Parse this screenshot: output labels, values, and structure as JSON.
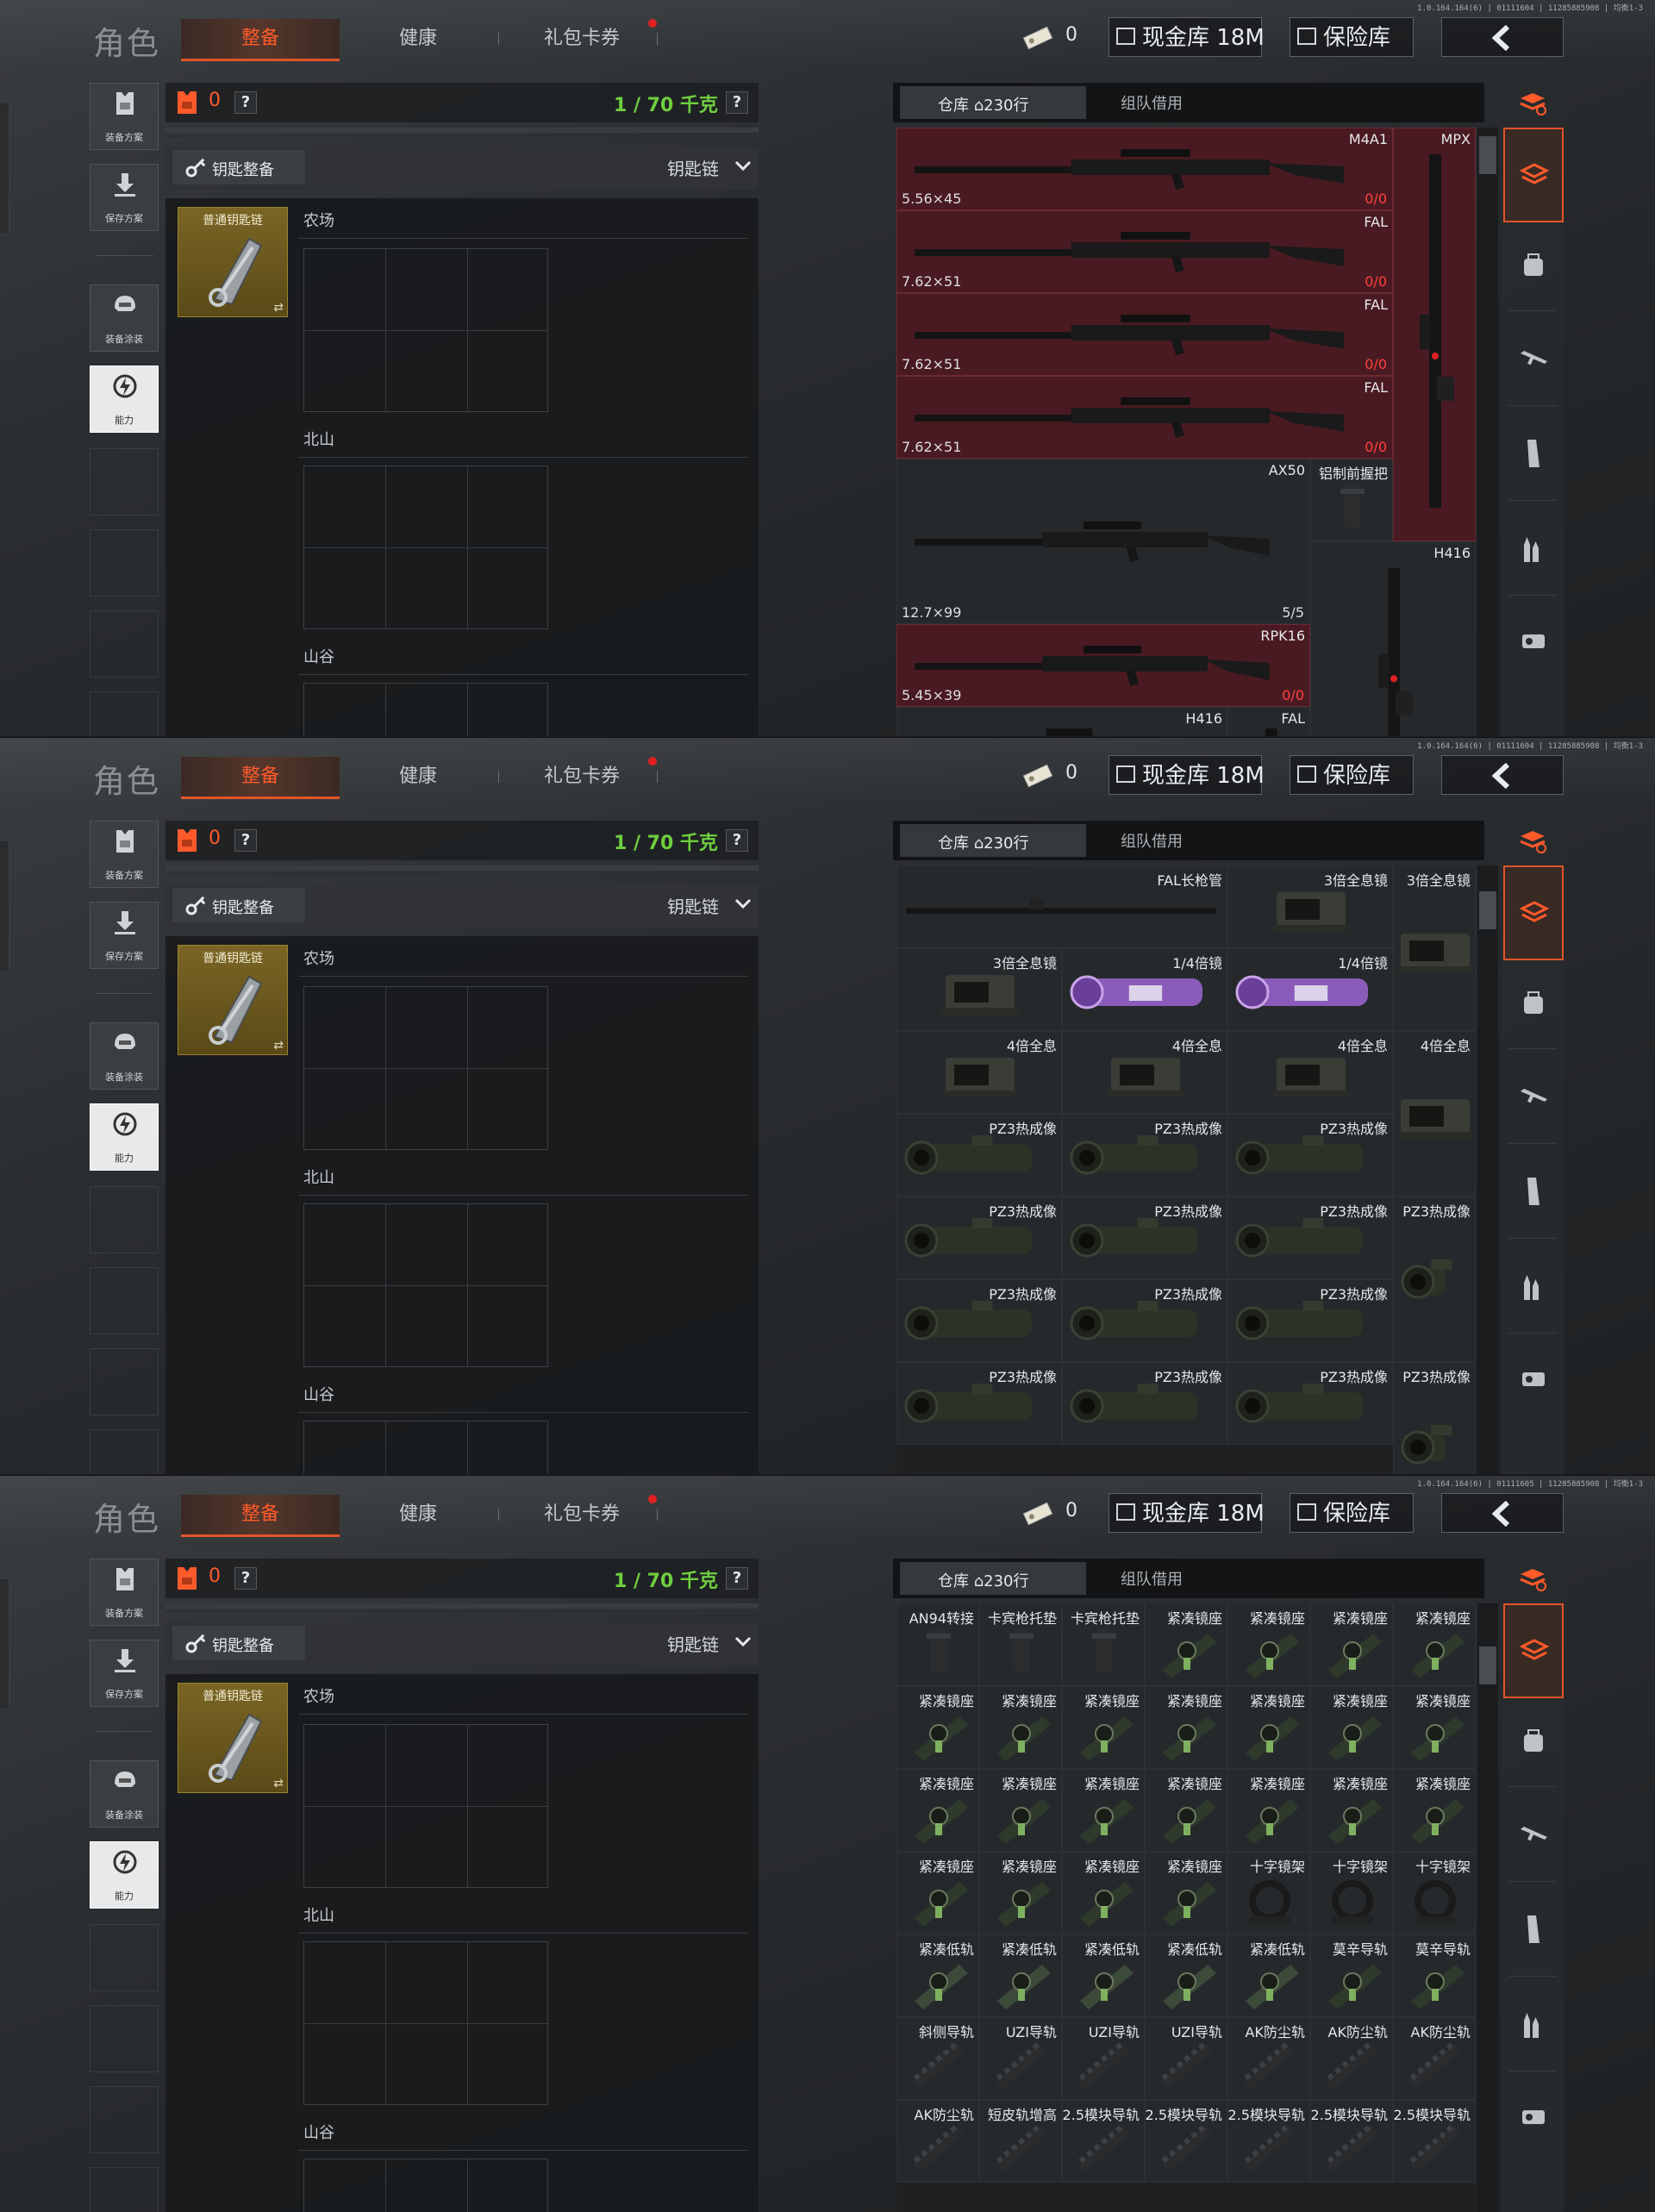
{
  "panels": [
    {
      "build": "1.0.164.164(6) | 01111604 | 11285885908 | 均衡1-3",
      "grid": [
        {
          "type": "gun",
          "red": true,
          "name": "M4A1",
          "caliber": "5.56×45",
          "ammo": "0/0",
          "c": 0,
          "r": 0,
          "w": 6,
          "h": 1
        },
        {
          "type": "gun",
          "red": true,
          "name": "MPX",
          "caliber": "",
          "ammo": "",
          "c": 6,
          "r": 0,
          "w": 1,
          "h": 5,
          "vertical": true
        },
        {
          "type": "gun",
          "red": true,
          "name": "FAL",
          "caliber": "7.62×51",
          "ammo": "0/0",
          "c": 0,
          "r": 1,
          "w": 6,
          "h": 1
        },
        {
          "type": "gun",
          "red": true,
          "name": "FAL",
          "caliber": "7.62×51",
          "ammo": "0/0",
          "c": 0,
          "r": 2,
          "w": 6,
          "h": 1
        },
        {
          "type": "gun",
          "red": true,
          "name": "FAL",
          "caliber": "7.62×51",
          "ammo": "0/0",
          "c": 0,
          "r": 3,
          "w": 6,
          "h": 1
        },
        {
          "type": "gun",
          "red": false,
          "name": "AX50",
          "caliber": "12.7×99",
          "ammo": "5/5",
          "c": 0,
          "r": 4,
          "w": 5,
          "h": 2
        },
        {
          "type": "part",
          "red": false,
          "name": "铝制前握把",
          "caliber": "",
          "ammo": "",
          "c": 5,
          "r": 4,
          "w": 1,
          "h": 1
        },
        {
          "type": "gun",
          "red": false,
          "name": "H416",
          "caliber": "",
          "ammo": "",
          "c": 5,
          "r": 5,
          "w": 2,
          "h": 3,
          "vertical": true
        },
        {
          "type": "gun",
          "red": true,
          "name": "RPK16",
          "caliber": "5.45×39",
          "ammo": "0/0",
          "c": 0,
          "r": 6,
          "w": 5,
          "h": 1
        },
        {
          "type": "gun",
          "red": false,
          "name": "H416",
          "caliber": "",
          "ammo": "",
          "c": 0,
          "r": 7,
          "w": 4,
          "h": 1
        },
        {
          "type": "gun",
          "red": false,
          "name": "FAL",
          "caliber": "",
          "ammo": "",
          "c": 4,
          "r": 7,
          "w": 1,
          "h": 1
        }
      ]
    },
    {
      "build": "1.0.164.164(6) | 01111604 | 11285885908 | 均衡1-3",
      "grid": [
        {
          "type": "barrel",
          "name": "FAL长枪管",
          "c": 0,
          "r": 0,
          "w": 4,
          "h": 1
        },
        {
          "type": "scope",
          "name": "3倍全息镜",
          "c": 4,
          "r": 0,
          "w": 2,
          "h": 1
        },
        {
          "type": "scope",
          "name": "3倍全息镜",
          "c": 6,
          "r": 0,
          "w": 1,
          "h": 2
        },
        {
          "type": "scope",
          "name": "3倍全息镜",
          "c": 0,
          "r": 1,
          "w": 2,
          "h": 1
        },
        {
          "type": "purple",
          "name": "1/4倍镜",
          "c": 2,
          "r": 1,
          "w": 2,
          "h": 1
        },
        {
          "type": "purple",
          "name": "1/4倍镜",
          "c": 4,
          "r": 1,
          "w": 2,
          "h": 1
        },
        {
          "type": "scope",
          "name": "4倍全息",
          "c": 0,
          "r": 2,
          "w": 2,
          "h": 1
        },
        {
          "type": "scope",
          "name": "4倍全息",
          "c": 2,
          "r": 2,
          "w": 2,
          "h": 1
        },
        {
          "type": "scope",
          "name": "4倍全息",
          "c": 4,
          "r": 2,
          "w": 2,
          "h": 1
        },
        {
          "type": "scope",
          "name": "4倍全息",
          "c": 6,
          "r": 2,
          "w": 1,
          "h": 2
        },
        {
          "type": "thermal",
          "name": "PZ3热成像",
          "c": 0,
          "r": 3,
          "w": 2,
          "h": 1
        },
        {
          "type": "thermal",
          "name": "PZ3热成像",
          "c": 2,
          "r": 3,
          "w": 2,
          "h": 1
        },
        {
          "type": "thermal",
          "name": "PZ3热成像",
          "c": 4,
          "r": 3,
          "w": 2,
          "h": 1
        },
        {
          "type": "thermal",
          "name": "PZ3热成像",
          "c": 0,
          "r": 4,
          "w": 2,
          "h": 1
        },
        {
          "type": "thermal",
          "name": "PZ3热成像",
          "c": 2,
          "r": 4,
          "w": 2,
          "h": 1
        },
        {
          "type": "thermal",
          "name": "PZ3热成像",
          "c": 4,
          "r": 4,
          "w": 2,
          "h": 1
        },
        {
          "type": "thermal",
          "name": "PZ3热成像",
          "c": 6,
          "r": 4,
          "w": 1,
          "h": 2
        },
        {
          "type": "thermal",
          "name": "PZ3热成像",
          "c": 0,
          "r": 5,
          "w": 2,
          "h": 1
        },
        {
          "type": "thermal",
          "name": "PZ3热成像",
          "c": 2,
          "r": 5,
          "w": 2,
          "h": 1
        },
        {
          "type": "thermal",
          "name": "PZ3热成像",
          "c": 4,
          "r": 5,
          "w": 2,
          "h": 1
        },
        {
          "type": "thermal",
          "name": "PZ3热成像",
          "c": 0,
          "r": 6,
          "w": 2,
          "h": 1
        },
        {
          "type": "thermal",
          "name": "PZ3热成像",
          "c": 2,
          "r": 6,
          "w": 2,
          "h": 1
        },
        {
          "type": "thermal",
          "name": "PZ3热成像",
          "c": 4,
          "r": 6,
          "w": 2,
          "h": 1
        },
        {
          "type": "thermal",
          "name": "PZ3热成像",
          "c": 6,
          "r": 6,
          "w": 1,
          "h": 2
        }
      ]
    },
    {
      "build": "1.0.164.164(6) | 01111605 | 11285885908 | 均衡1-3",
      "grid": [
        {
          "type": "part",
          "name": "AN94转接",
          "c": 0,
          "r": 0,
          "w": 1,
          "h": 1
        },
        {
          "type": "part",
          "name": "卡宾枪托垫",
          "c": 1,
          "r": 0,
          "w": 1,
          "h": 1
        },
        {
          "type": "part",
          "name": "卡宾枪托垫",
          "c": 2,
          "r": 0,
          "w": 1,
          "h": 1
        },
        {
          "type": "mount",
          "name": "紧凑镜座",
          "c": 3,
          "r": 0,
          "w": 1,
          "h": 1
        },
        {
          "type": "mount",
          "name": "紧凑镜座",
          "c": 4,
          "r": 0,
          "w": 1,
          "h": 1
        },
        {
          "type": "mount",
          "name": "紧凑镜座",
          "c": 5,
          "r": 0,
          "w": 1,
          "h": 1
        },
        {
          "type": "mount",
          "name": "紧凑镜座",
          "c": 6,
          "r": 0,
          "w": 1,
          "h": 1
        },
        {
          "type": "mount",
          "name": "紧凑镜座",
          "c": 0,
          "r": 1,
          "w": 1,
          "h": 1
        },
        {
          "type": "mount",
          "name": "紧凑镜座",
          "c": 1,
          "r": 1,
          "w": 1,
          "h": 1
        },
        {
          "type": "mount",
          "name": "紧凑镜座",
          "c": 2,
          "r": 1,
          "w": 1,
          "h": 1
        },
        {
          "type": "mount",
          "name": "紧凑镜座",
          "c": 3,
          "r": 1,
          "w": 1,
          "h": 1
        },
        {
          "type": "mount",
          "name": "紧凑镜座",
          "c": 4,
          "r": 1,
          "w": 1,
          "h": 1
        },
        {
          "type": "mount",
          "name": "紧凑镜座",
          "c": 5,
          "r": 1,
          "w": 1,
          "h": 1
        },
        {
          "type": "mount",
          "name": "紧凑镜座",
          "c": 6,
          "r": 1,
          "w": 1,
          "h": 1
        },
        {
          "type": "mount",
          "name": "紧凑镜座",
          "c": 0,
          "r": 2,
          "w": 1,
          "h": 1
        },
        {
          "type": "mount",
          "name": "紧凑镜座",
          "c": 1,
          "r": 2,
          "w": 1,
          "h": 1
        },
        {
          "type": "mount",
          "name": "紧凑镜座",
          "c": 2,
          "r": 2,
          "w": 1,
          "h": 1
        },
        {
          "type": "mount",
          "name": "紧凑镜座",
          "c": 3,
          "r": 2,
          "w": 1,
          "h": 1
        },
        {
          "type": "mount",
          "name": "紧凑镜座",
          "c": 4,
          "r": 2,
          "w": 1,
          "h": 1
        },
        {
          "type": "mount",
          "name": "紧凑镜座",
          "c": 5,
          "r": 2,
          "w": 1,
          "h": 1
        },
        {
          "type": "mount",
          "name": "紧凑镜座",
          "c": 6,
          "r": 2,
          "w": 1,
          "h": 1
        },
        {
          "type": "mount",
          "name": "紧凑镜座",
          "c": 0,
          "r": 3,
          "w": 1,
          "h": 1
        },
        {
          "type": "mount",
          "name": "紧凑镜座",
          "c": 1,
          "r": 3,
          "w": 1,
          "h": 1
        },
        {
          "type": "mount",
          "name": "紧凑镜座",
          "c": 2,
          "r": 3,
          "w": 1,
          "h": 1
        },
        {
          "type": "mount",
          "name": "紧凑镜座",
          "c": 3,
          "r": 3,
          "w": 1,
          "h": 1
        },
        {
          "type": "ring",
          "name": "十字镜架",
          "c": 4,
          "r": 3,
          "w": 1,
          "h": 1
        },
        {
          "type": "ring",
          "name": "十字镜架",
          "c": 5,
          "r": 3,
          "w": 1,
          "h": 1
        },
        {
          "type": "ring",
          "name": "十字镜架",
          "c": 6,
          "r": 3,
          "w": 1,
          "h": 1
        },
        {
          "type": "lowrail",
          "name": "紧凑低轨",
          "c": 0,
          "r": 4,
          "w": 1,
          "h": 1
        },
        {
          "type": "lowrail",
          "name": "紧凑低轨",
          "c": 1,
          "r": 4,
          "w": 1,
          "h": 1
        },
        {
          "type": "lowrail",
          "name": "紧凑低轨",
          "c": 2,
          "r": 4,
          "w": 1,
          "h": 1
        },
        {
          "type": "lowrail",
          "name": "紧凑低轨",
          "c": 3,
          "r": 4,
          "w": 1,
          "h": 1
        },
        {
          "type": "lowrail",
          "name": "紧凑低轨",
          "c": 4,
          "r": 4,
          "w": 1,
          "h": 1
        },
        {
          "type": "mount",
          "name": "莫辛导轨",
          "c": 5,
          "r": 4,
          "w": 1,
          "h": 1
        },
        {
          "type": "mount",
          "name": "莫辛导轨",
          "c": 6,
          "r": 4,
          "w": 1,
          "h": 1
        },
        {
          "type": "rail",
          "name": "斜侧导轨",
          "c": 0,
          "r": 5,
          "w": 1,
          "h": 1
        },
        {
          "type": "rail",
          "name": "UZI导轨",
          "c": 1,
          "r": 5,
          "w": 1,
          "h": 1
        },
        {
          "type": "rail",
          "name": "UZI导轨",
          "c": 2,
          "r": 5,
          "w": 1,
          "h": 1
        },
        {
          "type": "rail",
          "name": "UZI导轨",
          "c": 3,
          "r": 5,
          "w": 1,
          "h": 1
        },
        {
          "type": "rail",
          "name": "AK防尘轨",
          "c": 4,
          "r": 5,
          "w": 1,
          "h": 1
        },
        {
          "type": "rail",
          "name": "AK防尘轨",
          "c": 5,
          "r": 5,
          "w": 1,
          "h": 1
        },
        {
          "type": "rail",
          "name": "AK防尘轨",
          "c": 6,
          "r": 5,
          "w": 1,
          "h": 1
        },
        {
          "type": "rail",
          "name": "AK防尘轨",
          "c": 0,
          "r": 6,
          "w": 1,
          "h": 1
        },
        {
          "type": "rail",
          "name": "短皮轨增高",
          "c": 1,
          "r": 6,
          "w": 1,
          "h": 1
        },
        {
          "type": "rail",
          "name": "2.5模块导轨",
          "c": 2,
          "r": 6,
          "w": 1,
          "h": 1
        },
        {
          "type": "rail",
          "name": "2.5模块导轨",
          "c": 3,
          "r": 6,
          "w": 1,
          "h": 1
        },
        {
          "type": "rail",
          "name": "2.5模块导轨",
          "c": 4,
          "r": 6,
          "w": 1,
          "h": 1
        },
        {
          "type": "rail",
          "name": "2.5模块导轨",
          "c": 5,
          "r": 6,
          "w": 1,
          "h": 1
        },
        {
          "type": "rail",
          "name": "2.5模块导轨",
          "c": 6,
          "r": 6,
          "w": 1,
          "h": 1
        }
      ]
    }
  ],
  "header": {
    "title": "角色",
    "tabs": [
      {
        "label": "整备"
      },
      {
        "label": "健康"
      },
      {
        "label": "礼包卡券"
      }
    ],
    "ticket_count": "0",
    "cash_label": "现金库 18M",
    "safe_label": "保险库"
  },
  "side": {
    "loadout_plan": "装备方案",
    "save_plan": "保存方案",
    "skin": "装备涂装",
    "ability": "能力"
  },
  "loadout": {
    "vest_count": "0",
    "weight": "1 / 70 千克",
    "key_header": "钥匙整备",
    "key_chain": "钥匙链",
    "key_item": "普通钥匙链",
    "maps": [
      "农场",
      "北山",
      "山谷"
    ]
  },
  "storage": {
    "tab_label": "仓库",
    "rows": "230行",
    "tab2_label": "组队借用"
  },
  "colors": {
    "accent": "#e0542a",
    "weight_ok": "#6fcf3f",
    "ammo_empty": "#ff4040",
    "red_cell": "#4a1a22"
  }
}
